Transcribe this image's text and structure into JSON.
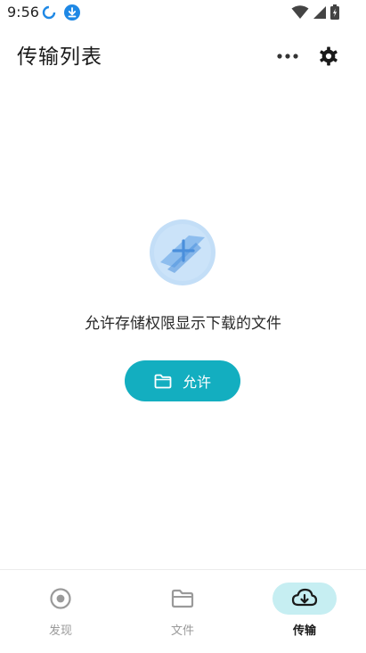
{
  "status_bar": {
    "time": "9:56",
    "icons": [
      "sync-icon",
      "download-icon",
      "wifi-icon",
      "signal-icon",
      "battery-icon"
    ]
  },
  "header": {
    "title": "传输列表",
    "more_icon": "more-horizontal-icon",
    "settings_icon": "gear-icon"
  },
  "empty_state": {
    "illustration": "transfer-illustration",
    "message": "允许存储权限显示下载的文件",
    "button_label": "允许",
    "button_icon": "folder-icon"
  },
  "bottom_nav": {
    "items": [
      {
        "label": "发现",
        "icon": "discover-icon",
        "active": false
      },
      {
        "label": "文件",
        "icon": "folder-icon",
        "active": false
      },
      {
        "label": "传输",
        "icon": "cloud-download-icon",
        "active": true
      }
    ]
  },
  "colors": {
    "accent": "#13aec0",
    "active_pill": "#c6eef2",
    "inactive_text": "#9a9a9a",
    "status_icon_blue": "#1e88e5"
  }
}
